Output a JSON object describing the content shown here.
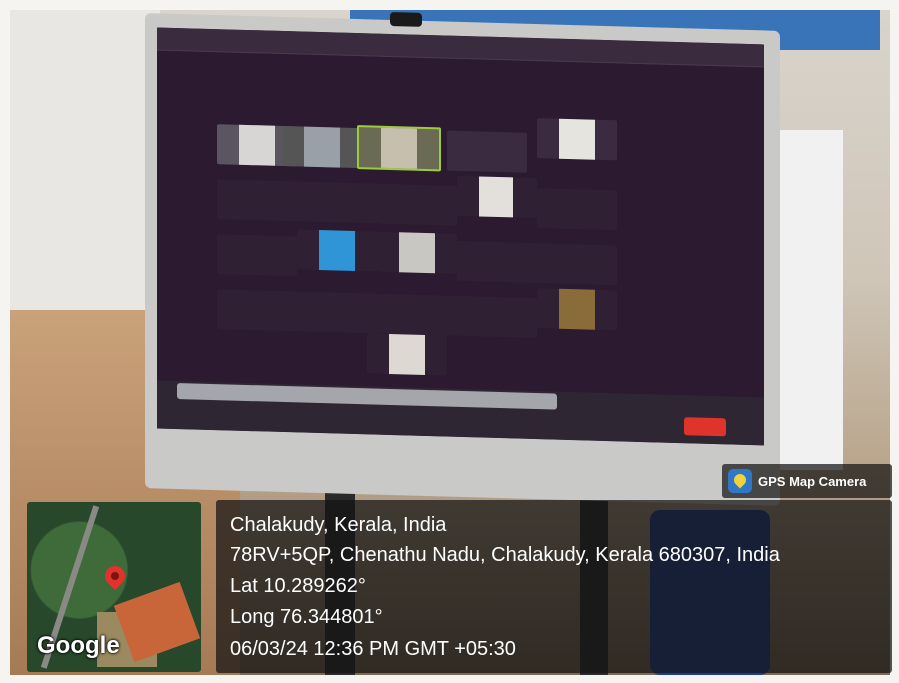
{
  "photo": {
    "screen_app": "video-conference",
    "leave_button_color": "#e0332b"
  },
  "badge": {
    "icon": "gps-map-camera-icon",
    "text": "GPS Map Camera"
  },
  "location": {
    "place": "Chalakudy, Kerala, India",
    "address": "78RV+5QP, Chenathu Nadu, Chalakudy, Kerala 680307, India",
    "lat": "Lat 10.289262°",
    "long": "Long 76.344801°",
    "datetime": "06/03/24 12:36 PM GMT +05:30"
  },
  "map": {
    "pin_icon": "map-pin-icon",
    "brand": "Google",
    "pin_color": "#e1322b"
  }
}
